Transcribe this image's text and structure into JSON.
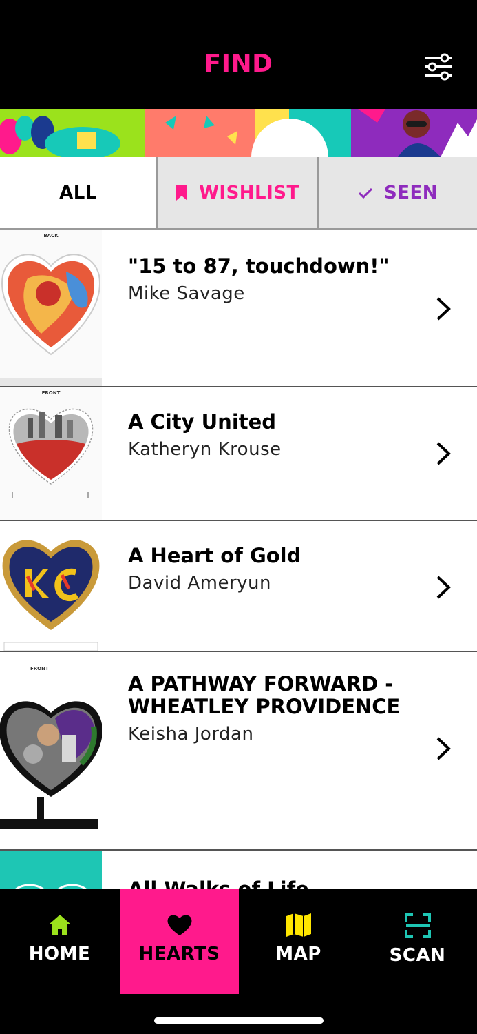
{
  "header": {
    "title": "FIND",
    "filter_icon": "sliders-icon"
  },
  "tabs": {
    "all": "ALL",
    "wishlist": "WISHLIST",
    "seen": "SEEN"
  },
  "list": {
    "items": [
      {
        "title": "\"15 to 87, touchdown!\"",
        "artist": "Mike Savage",
        "side": "BACK"
      },
      {
        "title": "A City United",
        "artist": "Katheryn Krouse",
        "side": "FRONT"
      },
      {
        "title": "A Heart of Gold",
        "artist": "David Ameryun",
        "side": ""
      },
      {
        "title": "A PATHWAY FORWARD - WHEATLEY PROVIDENCE",
        "artist": "Keisha Jordan",
        "side": "FRONT"
      },
      {
        "title": "All Walks of Life",
        "artist": "",
        "side": ""
      }
    ]
  },
  "nav": {
    "home": "HOME",
    "hearts": "HEARTS",
    "map": "MAP",
    "scan": "SCAN"
  },
  "colors": {
    "accent_pink": "#ff1a8c",
    "seen_purple": "#8e2bbd",
    "home_green": "#9be21c",
    "map_yellow": "#ffe600",
    "scan_teal": "#1ec6b4"
  }
}
